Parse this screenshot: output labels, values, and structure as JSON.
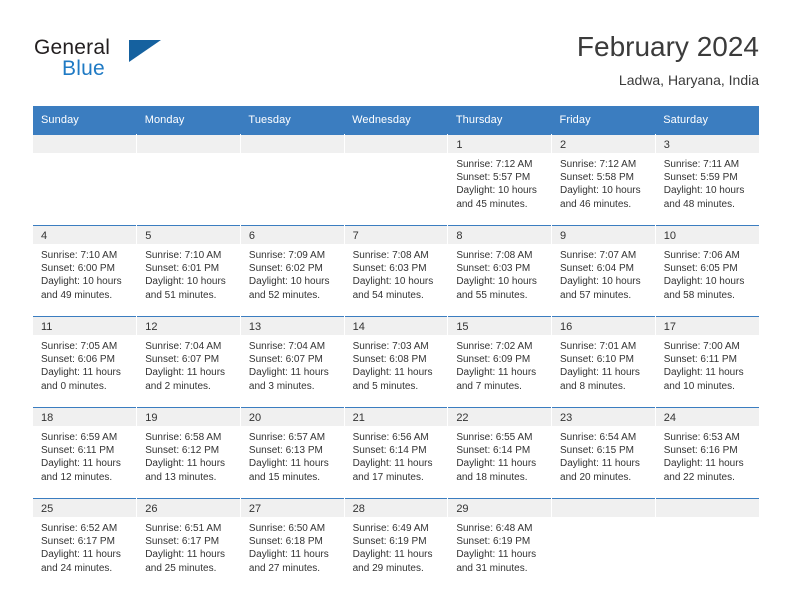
{
  "brand": {
    "name_top": "General",
    "name_bottom": "Blue",
    "triangle_color": "#15619f",
    "blue_color": "#1f7ac4"
  },
  "header": {
    "title": "February 2024",
    "subtitle": "Ladwa, Haryana, India",
    "header_bg": "#3b7dc0"
  },
  "weekday_headers": [
    "Sunday",
    "Monday",
    "Tuesday",
    "Wednesday",
    "Thursday",
    "Friday",
    "Saturday"
  ],
  "weeks": [
    [
      {
        "day": "",
        "empty": true
      },
      {
        "day": "",
        "empty": true
      },
      {
        "day": "",
        "empty": true
      },
      {
        "day": "",
        "empty": true
      },
      {
        "day": "1",
        "sunrise": "Sunrise: 7:12 AM",
        "sunset": "Sunset: 5:57 PM",
        "daylight": "Daylight: 10 hours and 45 minutes."
      },
      {
        "day": "2",
        "sunrise": "Sunrise: 7:12 AM",
        "sunset": "Sunset: 5:58 PM",
        "daylight": "Daylight: 10 hours and 46 minutes."
      },
      {
        "day": "3",
        "sunrise": "Sunrise: 7:11 AM",
        "sunset": "Sunset: 5:59 PM",
        "daylight": "Daylight: 10 hours and 48 minutes."
      }
    ],
    [
      {
        "day": "4",
        "sunrise": "Sunrise: 7:10 AM",
        "sunset": "Sunset: 6:00 PM",
        "daylight": "Daylight: 10 hours and 49 minutes."
      },
      {
        "day": "5",
        "sunrise": "Sunrise: 7:10 AM",
        "sunset": "Sunset: 6:01 PM",
        "daylight": "Daylight: 10 hours and 51 minutes."
      },
      {
        "day": "6",
        "sunrise": "Sunrise: 7:09 AM",
        "sunset": "Sunset: 6:02 PM",
        "daylight": "Daylight: 10 hours and 52 minutes."
      },
      {
        "day": "7",
        "sunrise": "Sunrise: 7:08 AM",
        "sunset": "Sunset: 6:03 PM",
        "daylight": "Daylight: 10 hours and 54 minutes."
      },
      {
        "day": "8",
        "sunrise": "Sunrise: 7:08 AM",
        "sunset": "Sunset: 6:03 PM",
        "daylight": "Daylight: 10 hours and 55 minutes."
      },
      {
        "day": "9",
        "sunrise": "Sunrise: 7:07 AM",
        "sunset": "Sunset: 6:04 PM",
        "daylight": "Daylight: 10 hours and 57 minutes."
      },
      {
        "day": "10",
        "sunrise": "Sunrise: 7:06 AM",
        "sunset": "Sunset: 6:05 PM",
        "daylight": "Daylight: 10 hours and 58 minutes."
      }
    ],
    [
      {
        "day": "11",
        "sunrise": "Sunrise: 7:05 AM",
        "sunset": "Sunset: 6:06 PM",
        "daylight": "Daylight: 11 hours and 0 minutes."
      },
      {
        "day": "12",
        "sunrise": "Sunrise: 7:04 AM",
        "sunset": "Sunset: 6:07 PM",
        "daylight": "Daylight: 11 hours and 2 minutes."
      },
      {
        "day": "13",
        "sunrise": "Sunrise: 7:04 AM",
        "sunset": "Sunset: 6:07 PM",
        "daylight": "Daylight: 11 hours and 3 minutes."
      },
      {
        "day": "14",
        "sunrise": "Sunrise: 7:03 AM",
        "sunset": "Sunset: 6:08 PM",
        "daylight": "Daylight: 11 hours and 5 minutes."
      },
      {
        "day": "15",
        "sunrise": "Sunrise: 7:02 AM",
        "sunset": "Sunset: 6:09 PM",
        "daylight": "Daylight: 11 hours and 7 minutes."
      },
      {
        "day": "16",
        "sunrise": "Sunrise: 7:01 AM",
        "sunset": "Sunset: 6:10 PM",
        "daylight": "Daylight: 11 hours and 8 minutes."
      },
      {
        "day": "17",
        "sunrise": "Sunrise: 7:00 AM",
        "sunset": "Sunset: 6:11 PM",
        "daylight": "Daylight: 11 hours and 10 minutes."
      }
    ],
    [
      {
        "day": "18",
        "sunrise": "Sunrise: 6:59 AM",
        "sunset": "Sunset: 6:11 PM",
        "daylight": "Daylight: 11 hours and 12 minutes."
      },
      {
        "day": "19",
        "sunrise": "Sunrise: 6:58 AM",
        "sunset": "Sunset: 6:12 PM",
        "daylight": "Daylight: 11 hours and 13 minutes."
      },
      {
        "day": "20",
        "sunrise": "Sunrise: 6:57 AM",
        "sunset": "Sunset: 6:13 PM",
        "daylight": "Daylight: 11 hours and 15 minutes."
      },
      {
        "day": "21",
        "sunrise": "Sunrise: 6:56 AM",
        "sunset": "Sunset: 6:14 PM",
        "daylight": "Daylight: 11 hours and 17 minutes."
      },
      {
        "day": "22",
        "sunrise": "Sunrise: 6:55 AM",
        "sunset": "Sunset: 6:14 PM",
        "daylight": "Daylight: 11 hours and 18 minutes."
      },
      {
        "day": "23",
        "sunrise": "Sunrise: 6:54 AM",
        "sunset": "Sunset: 6:15 PM",
        "daylight": "Daylight: 11 hours and 20 minutes."
      },
      {
        "day": "24",
        "sunrise": "Sunrise: 6:53 AM",
        "sunset": "Sunset: 6:16 PM",
        "daylight": "Daylight: 11 hours and 22 minutes."
      }
    ],
    [
      {
        "day": "25",
        "sunrise": "Sunrise: 6:52 AM",
        "sunset": "Sunset: 6:17 PM",
        "daylight": "Daylight: 11 hours and 24 minutes."
      },
      {
        "day": "26",
        "sunrise": "Sunrise: 6:51 AM",
        "sunset": "Sunset: 6:17 PM",
        "daylight": "Daylight: 11 hours and 25 minutes."
      },
      {
        "day": "27",
        "sunrise": "Sunrise: 6:50 AM",
        "sunset": "Sunset: 6:18 PM",
        "daylight": "Daylight: 11 hours and 27 minutes."
      },
      {
        "day": "28",
        "sunrise": "Sunrise: 6:49 AM",
        "sunset": "Sunset: 6:19 PM",
        "daylight": "Daylight: 11 hours and 29 minutes."
      },
      {
        "day": "29",
        "sunrise": "Sunrise: 6:48 AM",
        "sunset": "Sunset: 6:19 PM",
        "daylight": "Daylight: 11 hours and 31 minutes."
      },
      {
        "day": "",
        "empty": true
      },
      {
        "day": "",
        "empty": true
      }
    ]
  ]
}
